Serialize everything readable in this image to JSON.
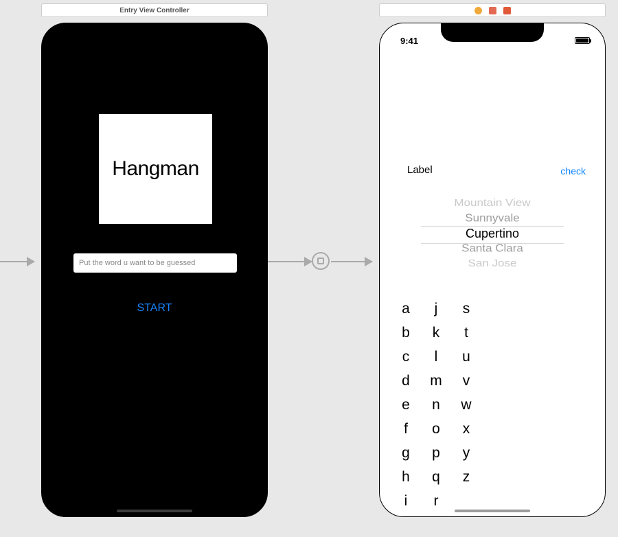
{
  "left_title": "Entry View Controller",
  "screen1": {
    "title": "Hangman",
    "placeholder": "Put the word u want to be guessed",
    "start": "START"
  },
  "screen2": {
    "time": "9:41",
    "label": "Label",
    "check": "check",
    "picker": {
      "opt0": "Mountain View",
      "opt1": "Sunnyvale",
      "selected": "Cupertino",
      "opt3": "Santa Clara",
      "opt4": "San Jose"
    },
    "alpha": {
      "c1": [
        "a",
        "b",
        "c",
        "d",
        "e",
        "f",
        "g",
        "h",
        "i"
      ],
      "c2": [
        "j",
        "k",
        "l",
        "m",
        "n",
        "o",
        "p",
        "q",
        "r"
      ],
      "c3": [
        "s",
        "t",
        "u",
        "v",
        "w",
        "x",
        "y",
        "z"
      ]
    }
  },
  "ib_icons": {
    "a": "#f0a93a",
    "b": "#e46a53",
    "c": "#e05a3a"
  }
}
